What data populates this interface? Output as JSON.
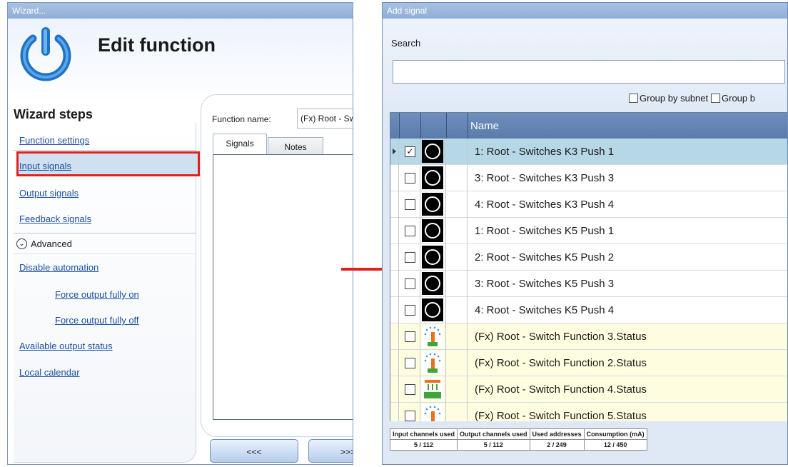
{
  "wizard": {
    "title": "Wizard...",
    "heading": "Edit function",
    "steps_heading": "Wizard steps",
    "steps": [
      {
        "label": "Function settings",
        "active": false
      },
      {
        "label": "Input signals",
        "active": true
      },
      {
        "label": "Output signals",
        "active": false
      },
      {
        "label": "Feedback signals",
        "active": false
      }
    ],
    "advanced_label": "Advanced",
    "advanced_steps": [
      {
        "label": "Disable automation",
        "indent": false
      },
      {
        "label": "Force output fully on",
        "indent": true
      },
      {
        "label": "Force output fully off",
        "indent": true
      },
      {
        "label": "Available output status",
        "indent": false
      },
      {
        "label": "Local calendar",
        "indent": false
      }
    ],
    "function_name_label": "Function name:",
    "function_name_value": "(Fx) Root - Switch Function",
    "tabs": [
      "Signals",
      "Notes"
    ],
    "nav_prev": "<<<",
    "nav_next": ">>>"
  },
  "add_signal": {
    "title": "Add signal",
    "search_label": "Search",
    "search_value": "",
    "group_by_subnet": "Group by subnet",
    "group_by_other": "Group b",
    "column_name": "Name",
    "rows": [
      {
        "name": "1: Root - Switches K3 Push 1",
        "checked": true,
        "selected": true,
        "icon": "push-button-icon",
        "function": false
      },
      {
        "name": "3: Root - Switches K3 Push 3",
        "checked": false,
        "selected": false,
        "icon": "push-button-icon",
        "function": false
      },
      {
        "name": "4: Root - Switches K3 Push 4",
        "checked": false,
        "selected": false,
        "icon": "push-button-icon",
        "function": false
      },
      {
        "name": "1: Root - Switches K5 Push 1",
        "checked": false,
        "selected": false,
        "icon": "push-button-icon",
        "function": false
      },
      {
        "name": "2: Root - Switches K5 Push 2",
        "checked": false,
        "selected": false,
        "icon": "push-button-icon",
        "function": false
      },
      {
        "name": "3: Root - Switches K5 Push 3",
        "checked": false,
        "selected": false,
        "icon": "push-button-icon",
        "function": false
      },
      {
        "name": "4: Root - Switches K5 Push 4",
        "checked": false,
        "selected": false,
        "icon": "push-button-icon",
        "function": false
      },
      {
        "name": "(Fx) Root - Switch Function 3.Status",
        "checked": false,
        "selected": false,
        "icon": "sprinkler-icon",
        "function": true
      },
      {
        "name": "(Fx) Root - Switch Function 2.Status",
        "checked": false,
        "selected": false,
        "icon": "sprinkler-icon",
        "function": true
      },
      {
        "name": "(Fx) Root - Switch Function 4.Status",
        "checked": false,
        "selected": false,
        "icon": "irrigation-icon",
        "function": true
      },
      {
        "name": "(Fx) Root - Switch Function 5.Status",
        "checked": false,
        "selected": false,
        "icon": "sprinkler-icon",
        "function": true
      }
    ],
    "status": {
      "headers": [
        "Input channels used",
        "Output channels used",
        "Used addresses",
        "Consumption (mA)"
      ],
      "values": [
        "5 / 112",
        "5 / 112",
        "2 / 249",
        "12 / 450"
      ]
    }
  },
  "colors": {
    "highlight_red": "#e3211c",
    "selected_row": "#b6d7e6",
    "function_row": "#fffde0",
    "header_blue": "#6386b4"
  }
}
